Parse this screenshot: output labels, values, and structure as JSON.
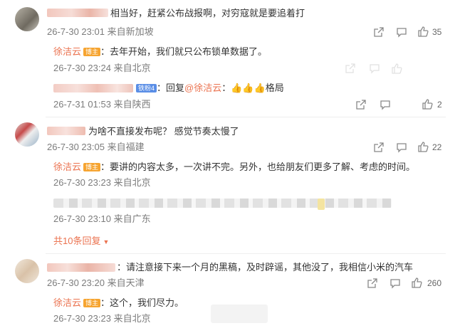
{
  "comments": [
    {
      "text": "相当好，赶紧公布战报啊，对穷寇就是要追着打",
      "meta": "26-7-30 23:01 来自新加坡",
      "likes": "35",
      "replies": [
        {
          "name": "徐洁云",
          "badge": "博主",
          "text": "：去年开始，我们就只公布锁单数据了。",
          "meta": "26-7-30 23:24 来自北京"
        },
        {
          "fan_badge": "铁粉4",
          "text_prefix": "：回复",
          "mention": "@徐洁云",
          "text_suffix": "：👍👍👍格局",
          "meta": "26-7-31 01:53 来自陕西",
          "likes": "2"
        }
      ]
    },
    {
      "text": "为啥不直接发布呢？  感觉节奏太慢了",
      "meta": "26-7-30 23:05 来自福建",
      "likes": "22",
      "replies": [
        {
          "name": "徐洁云",
          "badge": "博主",
          "text": "：要讲的内容太多，一次讲不完。另外，也给朋友们更多了解、考虑的时间。",
          "meta": "26-7-30 23:23 来自北京"
        },
        {
          "meta": "26-7-30 23:10 来自广东"
        }
      ],
      "more_replies": "共10条回复"
    },
    {
      "text": "：请注意接下来一个月的黑稿，及时辟谣，其他没了，我相信小米的汽车",
      "meta": "26-7-30 23:20 来自天津",
      "likes": "260",
      "replies": [
        {
          "name": "徐洁云",
          "badge": "博主",
          "text": "：这个，我们尽力。",
          "meta": "26-7-30 23:23 来自北京"
        }
      ]
    }
  ],
  "icons": {
    "share": "share-icon",
    "comment": "comment-icon",
    "like": "thumbs-up-icon"
  }
}
